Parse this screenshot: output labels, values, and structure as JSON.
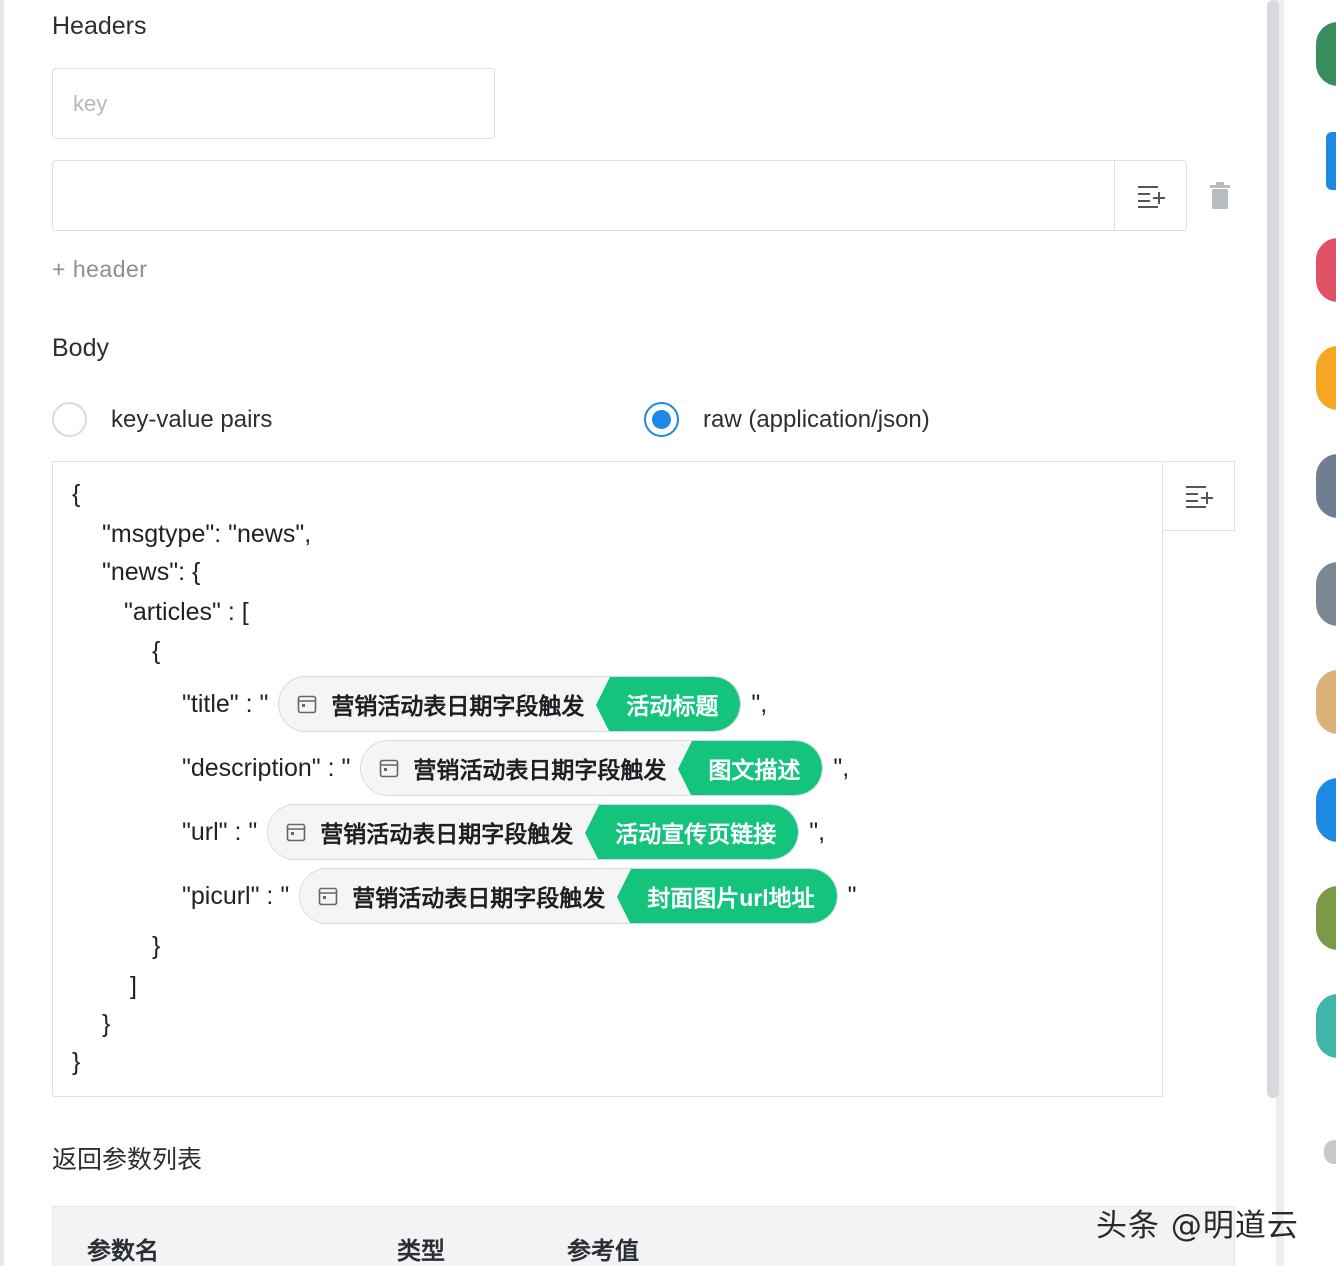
{
  "headers": {
    "title": "Headers",
    "key_placeholder": "key",
    "add_label": "+ header"
  },
  "body": {
    "title": "Body",
    "options": [
      {
        "label": "key-value pairs",
        "selected": false
      },
      {
        "label": "raw (application/json)",
        "selected": true
      }
    ]
  },
  "json_editor": {
    "lines": {
      "open": "{",
      "msgtype": "\"msgtype\": \"news\",",
      "news": "\"news\": {",
      "articles": "\"articles\" : [",
      "obj_open": "{",
      "obj_close": "}",
      "arr_close": "]",
      "news_close": "}",
      "close": "}"
    },
    "fields": [
      {
        "key": "\"title\" : \"",
        "source": "营销活动表日期字段触发",
        "field": "活动标题",
        "tail": "\","
      },
      {
        "key": "\"description\" : \"",
        "source": "营销活动表日期字段触发",
        "field": "图文描述",
        "tail": "\","
      },
      {
        "key": "\"url\" : \"",
        "source": "营销活动表日期字段触发",
        "field": "活动宣传页链接",
        "tail": "\","
      },
      {
        "key": "\"picurl\" : \"",
        "source": "营销活动表日期字段触发",
        "field": "封面图片url地址",
        "tail": "\""
      }
    ]
  },
  "return_params": {
    "title": "返回参数列表",
    "columns": [
      "参数名",
      "类型",
      "参考值"
    ]
  },
  "watermark": "头条 @明道云",
  "colors": {
    "accent": "#1e88e5",
    "field_token": "#14c47c"
  },
  "icons": {
    "insert": "insert-field-icon",
    "delete": "trash-icon",
    "source": "calendar-icon"
  }
}
